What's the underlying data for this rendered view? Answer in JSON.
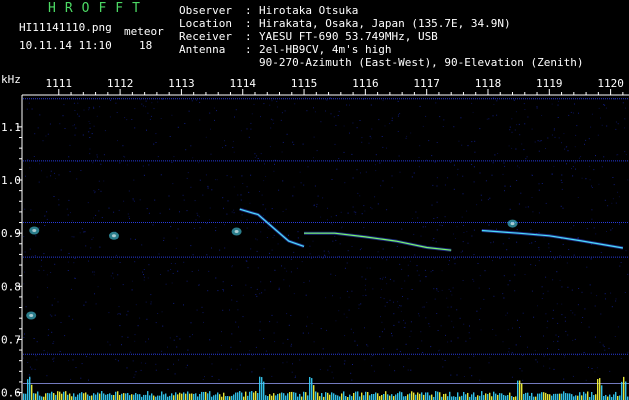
{
  "header": {
    "brand": "HROFFT",
    "filename": "HI11141110.png",
    "timestamp": "10.11.14 11:10",
    "meteor_label": "meteor",
    "meteor_count": "18",
    "info": [
      {
        "label": "Observer",
        "value": "Hirotaka Otsuka"
      },
      {
        "label": "Location",
        "value": "Hirakata, Osaka, Japan (135.7E, 34.9N)"
      },
      {
        "label": "Receiver",
        "value": "YAESU FT-690 53.749MHz, USB"
      },
      {
        "label": "Antenna",
        "value": "2el-HB9CV, 4m's high"
      },
      {
        "label": "",
        "value": "90-270-Azimuth (East-West), 90-Elevation (Zenith)"
      }
    ]
  },
  "colors": {
    "background": "#000000",
    "header_green": "#4cd964",
    "text_white": "#ffffff",
    "noise_blue": "#1a2cc8",
    "trace_cyan": "#4ee6ff",
    "trace_green": "#7dff6a",
    "activity_yellow": "#ffff3c",
    "activity_cyan": "#36d4ff"
  },
  "chart_data": {
    "type": "spectrogram",
    "ylabel": "kHz",
    "x_ticks": [
      "1111",
      "1112",
      "1113",
      "1114",
      "1115",
      "1116",
      "1117",
      "1118",
      "1119",
      "1120"
    ],
    "y_ticks": [
      "1.1",
      "1.0",
      "0.9",
      "0.8",
      "0.7",
      "0.6"
    ],
    "x_range": [
      1110.4,
      1120.3
    ],
    "y_range": [
      0.586,
      1.16
    ],
    "carrier_lines_khz": [
      1.153,
      1.036,
      0.92,
      0.855,
      0.672,
      0.617
    ],
    "meteor_traces": [
      {
        "name": "",
        "points": [
          [
            1113.95,
            0.945
          ],
          [
            1114.25,
            0.935
          ],
          [
            1114.55,
            0.905
          ],
          [
            1114.75,
            0.885
          ],
          [
            1115.0,
            0.875
          ]
        ]
      },
      {
        "name": "",
        "points": [
          [
            1115.0,
            0.9
          ],
          [
            1115.5,
            0.9
          ],
          [
            1116.0,
            0.893
          ],
          [
            1116.5,
            0.885
          ],
          [
            1117.0,
            0.873
          ],
          [
            1117.4,
            0.868
          ]
        ]
      },
      {
        "name": "",
        "points": [
          [
            1117.9,
            0.905
          ],
          [
            1118.5,
            0.9
          ],
          [
            1119.0,
            0.895
          ],
          [
            1119.5,
            0.886
          ],
          [
            1120.0,
            0.876
          ],
          [
            1120.2,
            0.872
          ]
        ]
      }
    ],
    "bursts": [
      {
        "x": 1110.6,
        "y": 0.905
      },
      {
        "x": 1110.55,
        "y": 0.745
      },
      {
        "x": 1111.9,
        "y": 0.895
      },
      {
        "x": 1113.9,
        "y": 0.903
      },
      {
        "x": 1118.4,
        "y": 0.918
      }
    ],
    "activity_peaks_x": [
      1110.5,
      1114.3,
      1115.1,
      1118.5,
      1119.8,
      1120.2
    ]
  }
}
